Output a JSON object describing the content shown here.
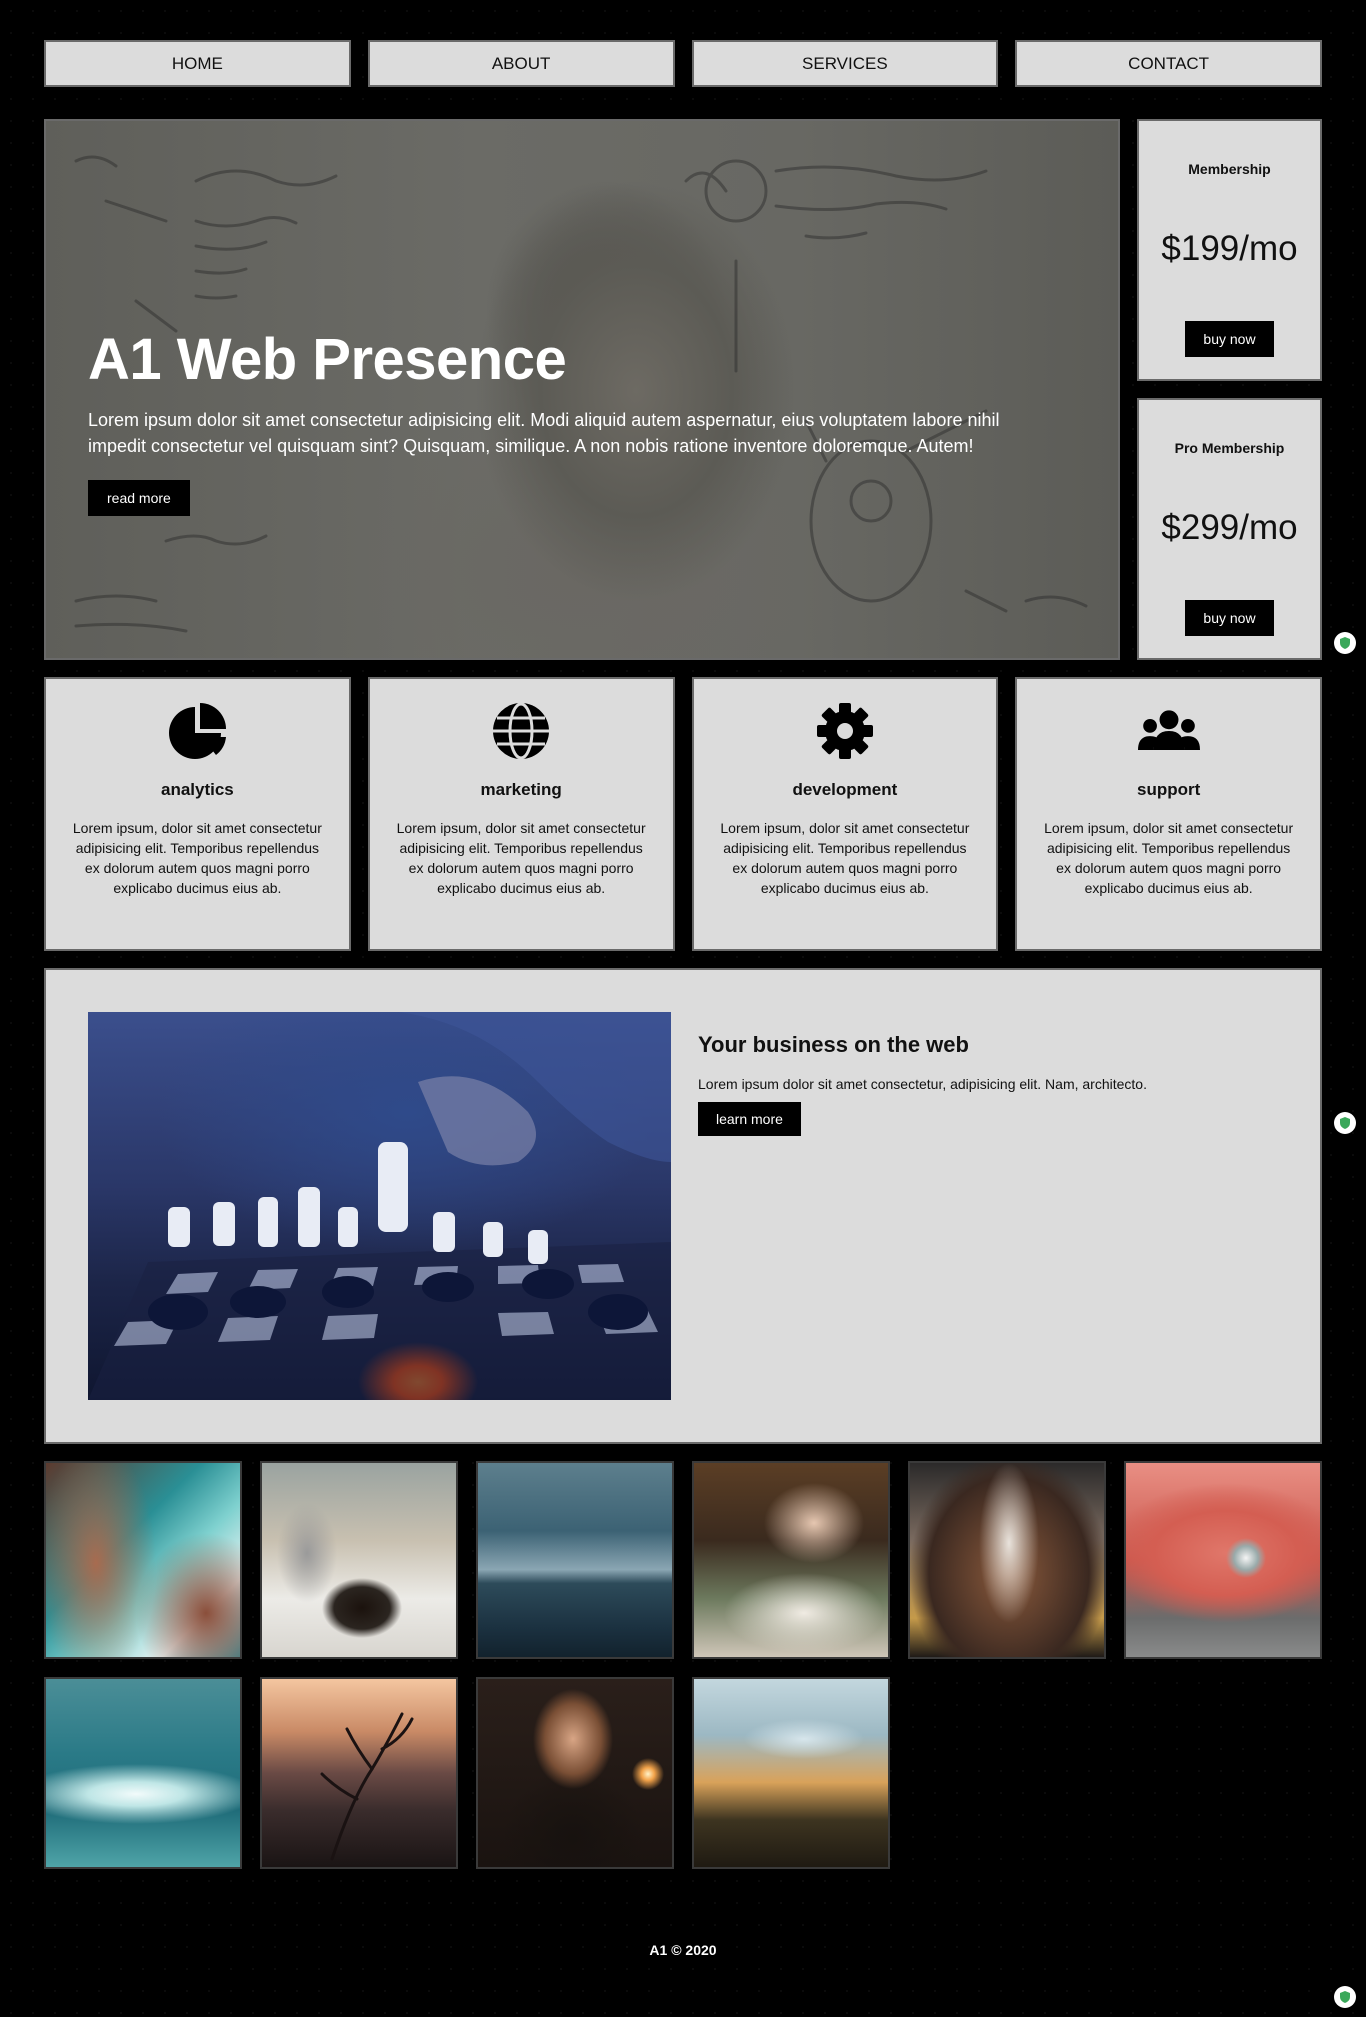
{
  "nav": {
    "items": [
      {
        "label": "HOME"
      },
      {
        "label": "ABOUT"
      },
      {
        "label": "SERVICES"
      },
      {
        "label": "CONTACT"
      }
    ]
  },
  "hero": {
    "title": "A1 Web Presence",
    "text": "Lorem ipsum dolor sit amet consectetur adipisicing elit. Modi aliquid autem aspernatur, eius voluptatem labore nihil impedit consectetur vel quisquam sint? Quisquam, similique. A non nobis ratione inventore doloremque. Autem!",
    "button": "read more"
  },
  "pricing": [
    {
      "name": "Membership",
      "price": "$199/mo",
      "button": "buy now"
    },
    {
      "name": "Pro Membership",
      "price": "$299/mo",
      "button": "buy now"
    }
  ],
  "services": [
    {
      "icon": "pie-chart-icon",
      "title": "analytics",
      "text": "Lorem ipsum, dolor sit amet consectetur adipisicing elit. Temporibus repellendus ex dolorum autem quos magni porro explicabo ducimus eius ab."
    },
    {
      "icon": "globe-icon",
      "title": "marketing",
      "text": "Lorem ipsum, dolor sit amet consectetur adipisicing elit. Temporibus repellendus ex dolorum autem quos magni porro explicabo ducimus eius ab."
    },
    {
      "icon": "gear-icon",
      "title": "development",
      "text": "Lorem ipsum, dolor sit amet consectetur adipisicing elit. Temporibus repellendus ex dolorum autem quos magni porro explicabo ducimus eius ab."
    },
    {
      "icon": "users-icon",
      "title": "support",
      "text": "Lorem ipsum, dolor sit amet consectetur adipisicing elit. Temporibus repellendus ex dolorum autem quos magni porro explicabo ducimus eius ab."
    }
  ],
  "feature": {
    "title": "Your business on the web",
    "text": "Lorem ipsum dolor sit amet consectetur, adipisicing elit. Nam, architecto.",
    "button": "learn more"
  },
  "gallery": [
    "rocky-coast-photo",
    "coffee-pourover-photo",
    "misty-lake-photo",
    "friends-dinner-photo",
    "escalator-tunnel-photo",
    "red-car-photo",
    "ocean-wave-photo",
    "bare-tree-sunset-photo",
    "woman-portrait-photo",
    "pine-forest-mountain-photo"
  ],
  "footer": {
    "text": "A1 © 2020"
  },
  "colors": {
    "panel": "#dcdcdc",
    "page": "#000000",
    "button": "#000000",
    "border": "#6a6a6a"
  }
}
